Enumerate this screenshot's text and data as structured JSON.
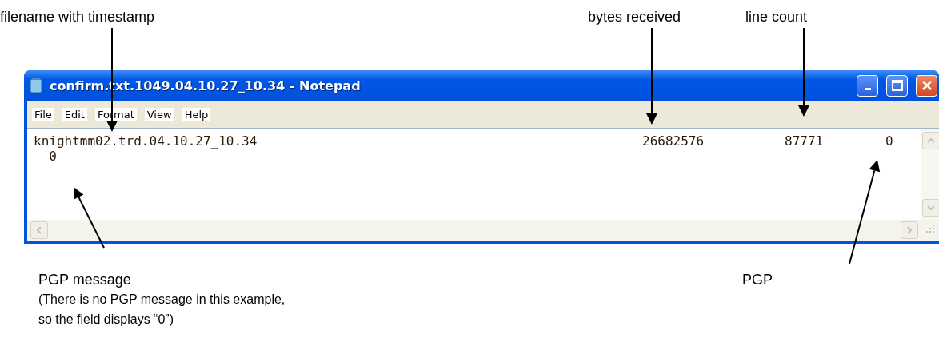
{
  "annotations_top": [
    "filename with timestamp",
    "bytes received",
    "line count"
  ],
  "window": {
    "title": "confirm.txt.1049.04.10.27_10.34 - Notepad",
    "menu": [
      "File",
      "Edit",
      "Format",
      "View",
      "Help"
    ],
    "lines": [
      {
        "fields": [
          "knightmm02.trd.04.10.27_10.34",
          "26682576",
          "87771",
          "0"
        ]
      },
      {
        "fields": [
          "  0"
        ]
      }
    ]
  },
  "annotations_bottom": [
    {
      "lines": [
        "PGP message",
        "(There is no PGP message in this example,",
        "so the field displays “0”)"
      ]
    },
    {
      "lines": [
        "PGP"
      ]
    }
  ]
}
